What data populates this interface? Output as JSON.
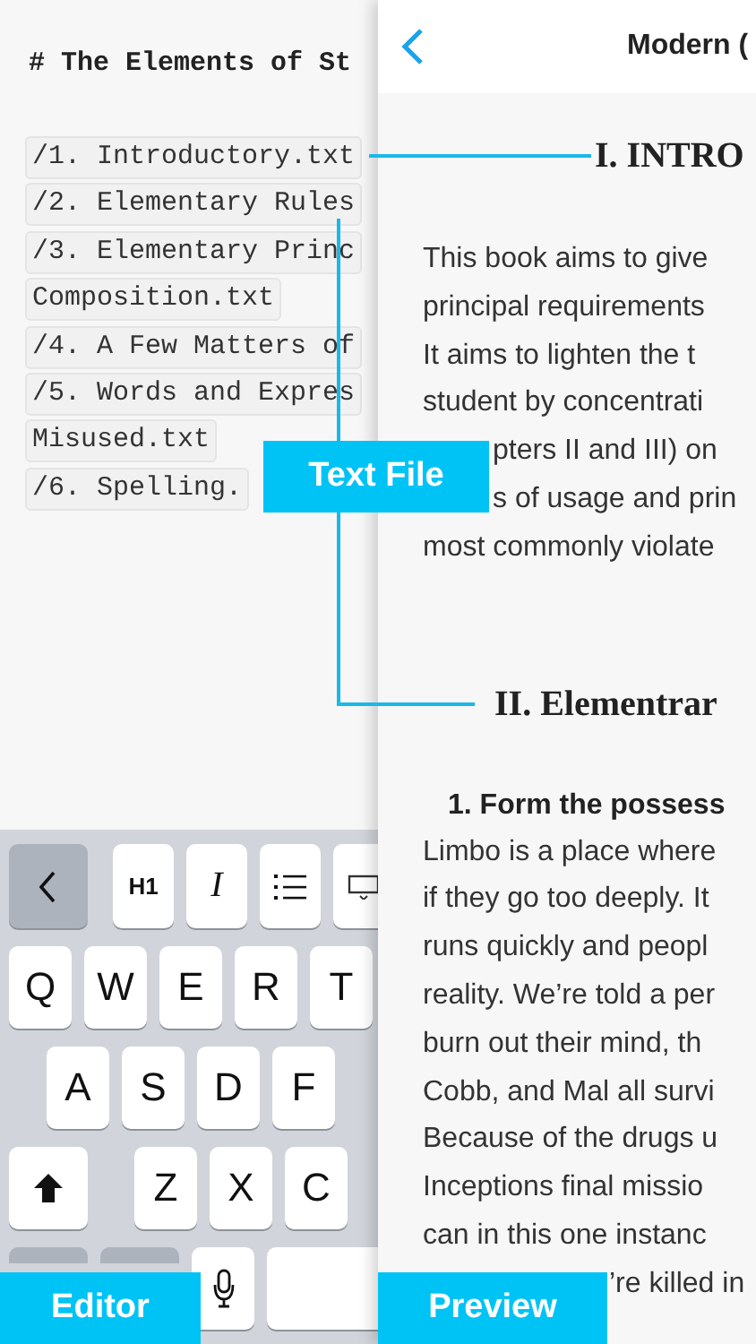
{
  "editor": {
    "heading": "# The Elements of St",
    "files": [
      "/1. Introductory.txt",
      "/2. Elementary Rules",
      "/3. Elementary Princ",
      "Composition.txt",
      "/4. A Few Matters of",
      "/5. Words and Expres",
      "Misused.txt",
      "/6. Spelling."
    ]
  },
  "keyboard": {
    "toolbar": [
      {
        "kind": "back"
      },
      {
        "kind": "text",
        "label": "H1"
      },
      {
        "kind": "italic",
        "label": "I"
      },
      {
        "kind": "list"
      },
      {
        "kind": "keyboard"
      }
    ],
    "rows": [
      [
        {
          "kind": "letter",
          "label": "Q"
        },
        {
          "kind": "letter",
          "label": "W"
        },
        {
          "kind": "letter",
          "label": "E"
        },
        {
          "kind": "letter",
          "label": "R"
        },
        {
          "kind": "letter",
          "label": "T"
        }
      ],
      [
        {
          "kind": "letter",
          "label": "A"
        },
        {
          "kind": "letter",
          "label": "S"
        },
        {
          "kind": "letter",
          "label": "D"
        },
        {
          "kind": "letter",
          "label": "F"
        }
      ],
      [
        {
          "kind": "shift"
        },
        {
          "kind": "letter",
          "label": "Z"
        },
        {
          "kind": "letter",
          "label": "X"
        },
        {
          "kind": "letter",
          "label": "C"
        }
      ],
      [
        {
          "kind": "blank"
        },
        {
          "kind": "blank"
        },
        {
          "kind": "mic"
        },
        {
          "kind": "space"
        }
      ]
    ]
  },
  "preview": {
    "title": "Modern (",
    "blocks": [
      {
        "kind": "h1",
        "text": "I. INTRO"
      },
      {
        "kind": "p",
        "lines": [
          {
            "text": "This book aims to give",
            "clipped_start": false
          },
          {
            "text": "principal requirements",
            "clipped_start": false
          },
          {
            "text": "It aims to lighten the t",
            "clipped_start": false
          },
          {
            "text": "student by concentrati",
            "clipped_start": false
          },
          {
            "text": "pters II and III) on",
            "clipped_start": true
          },
          {
            "text": "s of usage and prin",
            "clipped_start": true
          },
          {
            "text": "most commonly violate",
            "clipped_start": false
          }
        ]
      },
      {
        "kind": "h1",
        "text": "II. Elementrar"
      },
      {
        "kind": "h2",
        "text": "1. Form the possess"
      },
      {
        "kind": "p",
        "lines": [
          {
            "text": "Limbo is a place where",
            "clipped_start": false
          },
          {
            "text": "if they go too deeply. It",
            "clipped_start": false
          },
          {
            "text": "runs quickly and peopl",
            "clipped_start": false
          },
          {
            "text": "reality. We’re told a per",
            "clipped_start": false
          },
          {
            "text": "burn out their mind, th",
            "clipped_start": false
          },
          {
            "text": "Cobb, and Mal all survi",
            "clipped_start": false
          },
          {
            "text": "Because of the drugs u",
            "clipped_start": false
          },
          {
            "text": "Inceptions final missio",
            "clipped_start": false
          },
          {
            "text": "can in this one instanc",
            "clipped_start": false
          },
          {
            "text": "’re killed in",
            "clipped_start": true
          }
        ]
      }
    ]
  },
  "callouts": [
    {
      "label": "Text File"
    },
    {
      "label": "Editor"
    },
    {
      "label": "Preview"
    }
  ]
}
